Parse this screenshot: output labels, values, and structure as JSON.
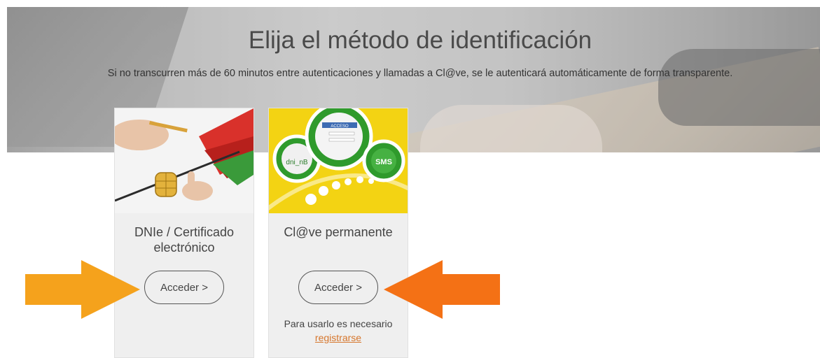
{
  "page": {
    "title": "Elija el método de identificación",
    "subtitle": "Si no transcurren más de 60 minutos entre autenticaciones y llamadas a Cl@ve, se le autenticará automáticamente de forma transparente."
  },
  "cards": [
    {
      "title": "DNIe / Certificado electrónico",
      "button_label": "Acceder  >"
    },
    {
      "title": "Cl@ve permanente",
      "button_label": "Acceder  >",
      "note": "Para usarlo es necesario",
      "register_link": "registrarse",
      "graphic_labels": {
        "dni": "dni_nB",
        "access": "ACCESO",
        "sms": "SMS"
      }
    }
  ],
  "colors": {
    "arrow_left": "#f5a21c",
    "arrow_right": "#f47115",
    "link": "#d6762c",
    "card_bg": "#efefef",
    "clave_yellow": "#f3d313",
    "clave_green": "#2f9a2c"
  },
  "icons": [
    "chip-icon",
    "pen-icon",
    "cloud-icon",
    "sms-bubble-icon",
    "login-window-icon",
    "arrow-right-icon",
    "arrow-left-icon"
  ]
}
